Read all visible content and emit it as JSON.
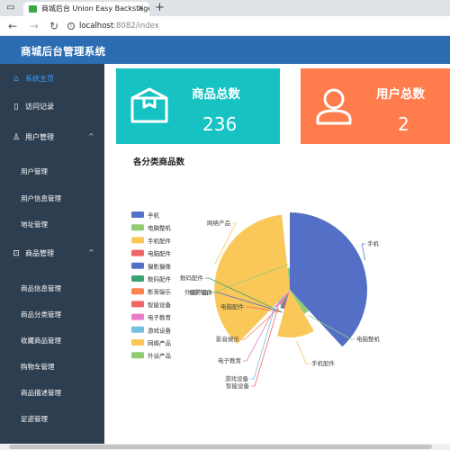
{
  "browser": {
    "sidebar_icon": "sidebar-toggle-icon",
    "tab_title": "商城后台 Union Easy Backstage",
    "tab_close": "✕",
    "new_tab": "+",
    "back": "←",
    "forward": "→",
    "reload": "↻",
    "url_host": "localhost",
    "url_path": ":8082/index"
  },
  "app": {
    "title": "商城后台管理系统"
  },
  "sidebar": {
    "items": [
      {
        "icon": "home-icon",
        "label": "系统主页",
        "active": true
      },
      {
        "icon": "book-icon",
        "label": "访问记录"
      },
      {
        "icon": "user-icon",
        "label": "用户管理",
        "chevron": "^"
      },
      {
        "label": "用户管理"
      },
      {
        "label": "用户信息管理"
      },
      {
        "label": "地址管理"
      },
      {
        "icon": "shopping-bag-icon",
        "label": "商品管理",
        "chevron": "^"
      },
      {
        "label": "商品信息管理"
      },
      {
        "label": "商品分类管理"
      },
      {
        "label": "收藏商品管理"
      },
      {
        "label": "购物车管理"
      },
      {
        "label": "商品描述管理"
      },
      {
        "label": "足迹管理"
      }
    ]
  },
  "cards": {
    "goods": {
      "label": "商品总数",
      "value": "236",
      "icon": "box-icon",
      "color": "#16c2c2"
    },
    "users": {
      "label": "用户总数",
      "value": "2",
      "icon": "user-icon",
      "color": "#ff7d4c"
    }
  },
  "chart_data": {
    "type": "pie",
    "title": "各分类商品数",
    "legend_placement": "left",
    "categories": [
      "手机",
      "电脑整机",
      "手机配件",
      "电脑配件",
      "摄影摄像",
      "数码配件",
      "影音娱乐",
      "智能设备",
      "电子教育",
      "游戏设备",
      "网络产品",
      "外设产品"
    ],
    "values": [
      90,
      8,
      30,
      3,
      3,
      3,
      2,
      2,
      4,
      2,
      85,
      4
    ],
    "colors": [
      "#5470c6",
      "#91cc75",
      "#fac858",
      "#ee6666",
      "#5470c6",
      "#3ba272",
      "#fc8452",
      "#ee6666",
      "#ea7ccc",
      "#73c0de",
      "#fac858",
      "#91cc75"
    ]
  }
}
